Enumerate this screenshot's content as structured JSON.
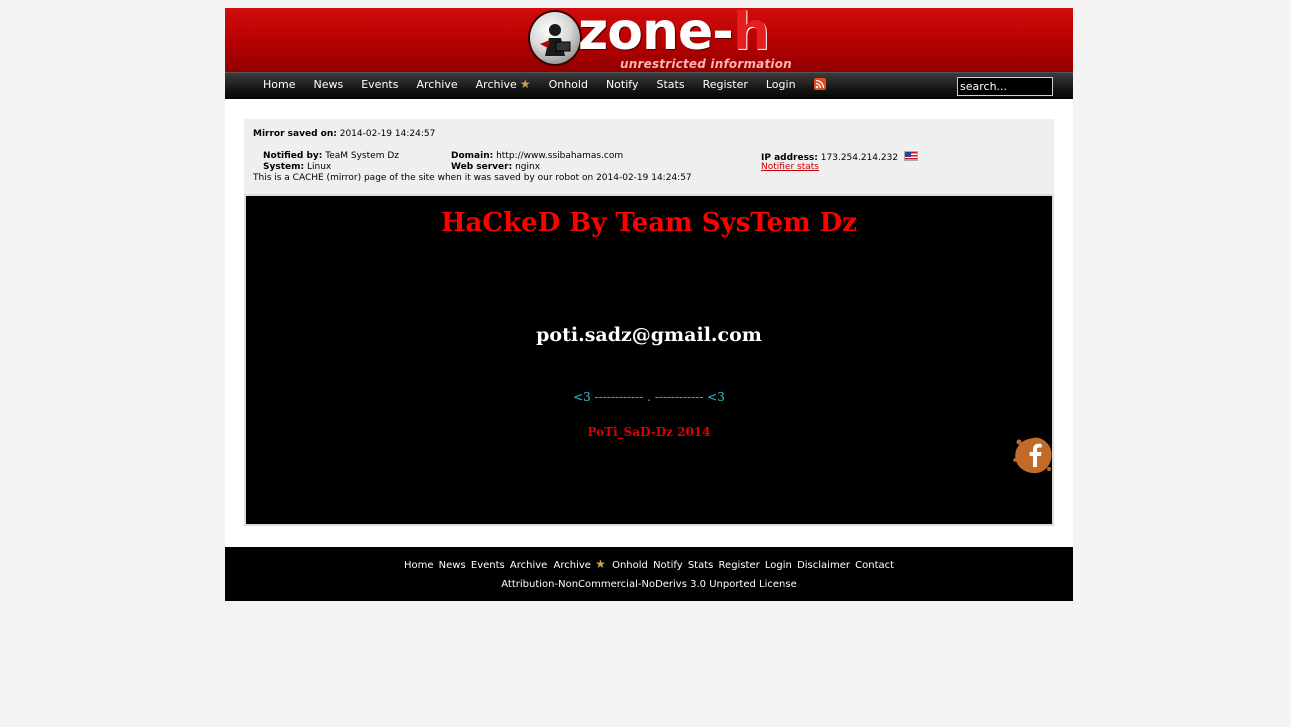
{
  "header": {
    "logo_word": "zone-",
    "logo_letter": "h",
    "tagline": "unrestricted information"
  },
  "nav": {
    "items": [
      "Home",
      "News",
      "Events",
      "Archive",
      "Archive",
      "Onhold",
      "Notify",
      "Stats",
      "Register",
      "Login"
    ],
    "search_placeholder": "search..."
  },
  "info": {
    "mirror_saved_label": "Mirror saved on:",
    "mirror_saved_value": "2014-02-19 14:24:57",
    "notified_by_label": "Notified by:",
    "notified_by_value": "TeaM System Dz",
    "domain_label": "Domain:",
    "domain_value": "http://www.ssibahamas.com",
    "ip_label": "IP address:",
    "ip_value": "173.254.214.232",
    "system_label": "System:",
    "system_value": "Linux",
    "webserver_label": "Web server:",
    "webserver_value": "nginx",
    "notifier_stats": "Notifier stats",
    "cache_note": "This is a CACHE (mirror) page of the site when it was saved by our robot on 2014-02-19 14:24:57"
  },
  "mirror": {
    "title": "HaCkeD By Team SysTem Dz",
    "email": "poti.sadz@gmail.com",
    "hearts": "<3 ------------   .   ------------ <3",
    "signature": "PoTi_SaD-Dz  2014",
    "colors": {
      "title": "#ff0000",
      "email": "#ffffff",
      "hearts": "#2fc3cf",
      "signature": "#e00000"
    }
  },
  "footer": {
    "links": [
      "Home",
      "News",
      "Events",
      "Archive",
      "Archive",
      "Onhold",
      "Notify",
      "Stats",
      "Register",
      "Login",
      "Disclaimer",
      "Contact"
    ],
    "license": "Attribution-NonCommercial-NoDerivs 3.0 Unported License"
  },
  "colors": {
    "header_red": "#c00000",
    "background": "#f3f3f3",
    "link_red": "#cc0000"
  },
  "icons": {
    "archive_star": "star-icon",
    "rss": "rss-icon",
    "flag": "us-flag-icon",
    "facebook": "facebook-icon",
    "globe": "globe-logo-icon"
  }
}
